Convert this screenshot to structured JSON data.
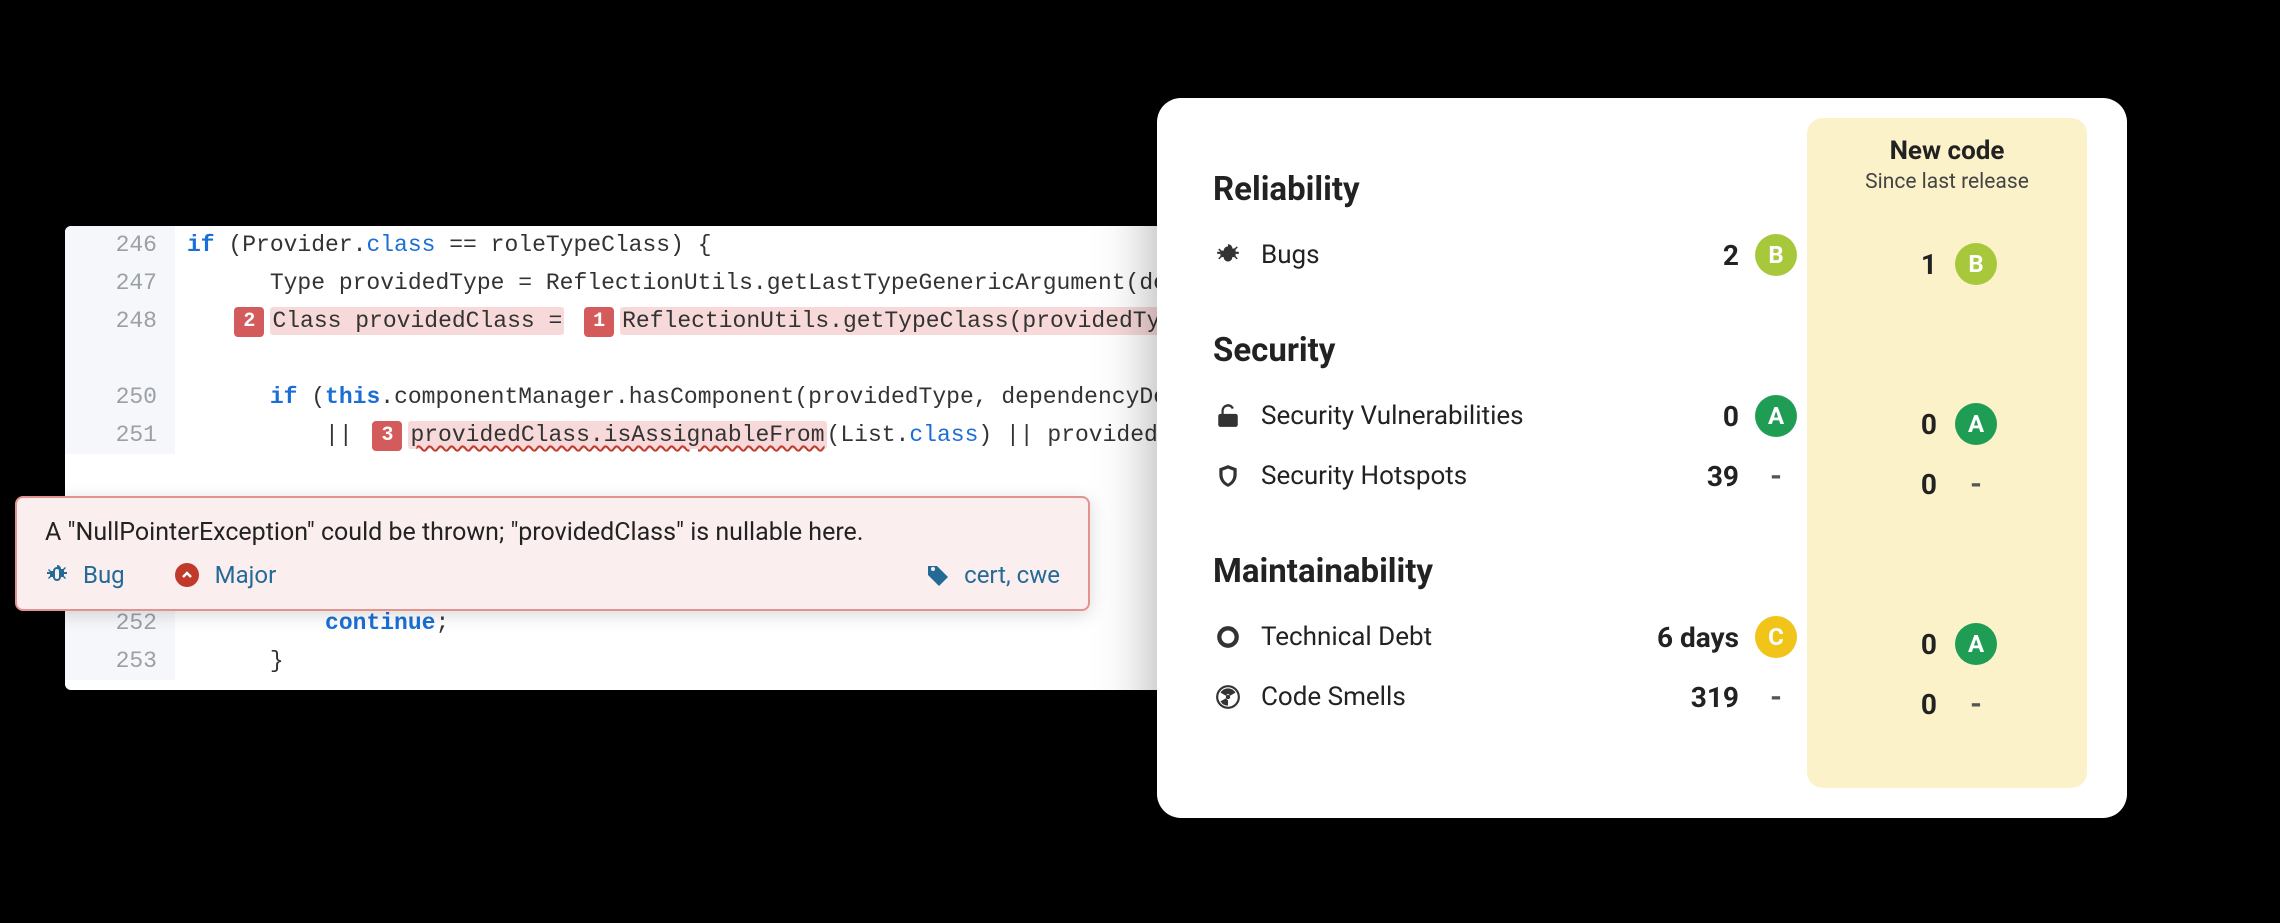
{
  "code": {
    "lines": [
      {
        "num": "246"
      },
      {
        "num": "247"
      },
      {
        "num": "248"
      },
      {
        "num": ""
      },
      {
        "num": "250"
      },
      {
        "num": "251"
      },
      {
        "num": "252"
      },
      {
        "num": "253"
      }
    ],
    "tokens": {
      "l246_if": "if",
      "l246_rest1": " (Provider.",
      "l246_class": "class",
      "l246_rest2": " == roleTypeClass) {",
      "l247": "      Type providedType = ReflectionUtils.getLastTypeGenericArgument(dependen",
      "l248_m1": "2",
      "l248_a": "Class providedClass =",
      "l248_m2": "1",
      "l248_b": "ReflectionUtils.getTypeClass(providedType);",
      "l250_if": "if",
      "l250_this": "this",
      "l250_rest": ".componentManager.hasComponent(providedType, dependencyDescript",
      "l251_pre": "          || ",
      "l251_m3": "3",
      "l251_sq": "providedClass.isAssignableFrom",
      "l251_rest1": "(List.",
      "l251_class": "class",
      "l251_rest2": ") || providedClass.",
      "l252_cont": "continue",
      "l252_semi": ";",
      "l253": "      }"
    }
  },
  "issue": {
    "title": "A \"NullPointerException\" could be thrown; \"providedClass\" is nullable here.",
    "type": "Bug",
    "severity": "Major",
    "tags": "cert, cwe"
  },
  "metrics": {
    "newcode_title": "New code",
    "newcode_sub": "Since last release",
    "sections": {
      "reliability": {
        "title": "Reliability",
        "bugs_label": "Bugs",
        "bugs_value": "2",
        "bugs_rating": "B",
        "bugs_new_value": "1",
        "bugs_new_rating": "B"
      },
      "security": {
        "title": "Security",
        "vuln_label": "Security Vulnerabilities",
        "vuln_value": "0",
        "vuln_rating": "A",
        "vuln_new_value": "0",
        "vuln_new_rating": "A",
        "hotspot_label": "Security Hotspots",
        "hotspot_value": "39",
        "hotspot_rating": "-",
        "hotspot_new_value": "0",
        "hotspot_new_rating": "-"
      },
      "maintainability": {
        "title": "Maintainability",
        "debt_label": "Technical Debt",
        "debt_value": "6 days",
        "debt_rating": "C",
        "debt_new_value": "0",
        "debt_new_rating": "A",
        "smells_label": "Code Smells",
        "smells_value": "319",
        "smells_rating": "-",
        "smells_new_value": "0",
        "smells_new_rating": "-"
      }
    }
  }
}
